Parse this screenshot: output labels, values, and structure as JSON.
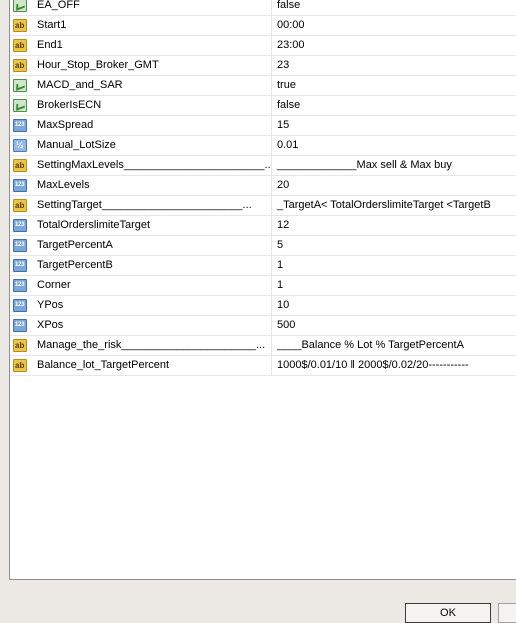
{
  "params": [
    {
      "icon": "bool-icon",
      "name": "EA_OFF",
      "value": "false"
    },
    {
      "icon": "string-icon",
      "name": "Start1",
      "value": "00:00"
    },
    {
      "icon": "string-icon",
      "name": "End1",
      "value": "23:00"
    },
    {
      "icon": "string-icon",
      "name": "Hour_Stop_Broker_GMT",
      "value": "23"
    },
    {
      "icon": "bool-icon",
      "name": "MACD_and_SAR",
      "value": "true"
    },
    {
      "icon": "bool-icon",
      "name": "BrokerIsECN",
      "value": "false"
    },
    {
      "icon": "integer-icon",
      "name": "MaxSpread",
      "value": "15"
    },
    {
      "icon": "double-icon",
      "name": "Manual_LotSize",
      "value": "0.01"
    },
    {
      "icon": "string-icon",
      "name": "SettingMaxLevels_______________________...",
      "value": "_____________Max sell & Max buy"
    },
    {
      "icon": "integer-icon",
      "name": "MaxLevels",
      "value": "20"
    },
    {
      "icon": "string-icon",
      "name": "SettingTarget_______________________...",
      "value": "_TargetA< TotalOrderslimiteTarget <TargetB"
    },
    {
      "icon": "integer-icon",
      "name": "TotalOrderslimiteTarget",
      "value": "12"
    },
    {
      "icon": "integer-icon",
      "name": "TargetPercentA",
      "value": "5"
    },
    {
      "icon": "integer-icon",
      "name": "TargetPercentB",
      "value": "1"
    },
    {
      "icon": "integer-icon",
      "name": "Corner",
      "value": "1"
    },
    {
      "icon": "integer-icon",
      "name": "YPos",
      "value": "10"
    },
    {
      "icon": "integer-icon",
      "name": "XPos",
      "value": "500"
    },
    {
      "icon": "string-icon",
      "name": "Manage_the_risk______________________...",
      "value": "____Balance % Lot % TargetPercentA"
    },
    {
      "icon": "string-icon",
      "name": "Balance_lot_TargetPercent",
      "value": "1000$/0.01/10  ‖  2000$/0.02/20-----------"
    }
  ],
  "buttons": {
    "ok_label": "OK"
  }
}
